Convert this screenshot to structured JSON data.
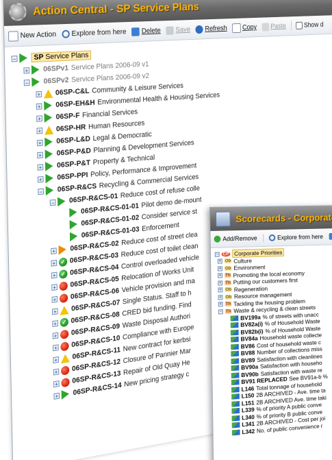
{
  "main_window": {
    "title": "Action Central - SP Service Plans",
    "toolbar": {
      "new_action": "New Action",
      "explore": "Explore from here",
      "delete": "Delete",
      "save": "Save",
      "refresh": "Refresh",
      "copy": "Copy",
      "paste": "Paste",
      "show": "Show d"
    },
    "root": {
      "code": "SP",
      "label": "Service Plans"
    },
    "items": [
      {
        "code": "06SPv1",
        "desc": "Service Plans 2006-09 v1",
        "status": "flag-green",
        "grey": true,
        "indent": 1,
        "exp": "+"
      },
      {
        "code": "06SPv2",
        "desc": "Service Plans 2006-09 v2",
        "status": "flag-green",
        "grey": true,
        "indent": 1,
        "exp": "-"
      },
      {
        "code": "06SP-C&L",
        "desc": "Community & Leisure Services",
        "status": "triangle",
        "indent": 2,
        "exp": "+"
      },
      {
        "code": "06SP-EH&H",
        "desc": "Environmental Health & Housing Services",
        "status": "flag-green",
        "indent": 2,
        "exp": "+"
      },
      {
        "code": "06SP-F",
        "desc": "Financial Services",
        "status": "flag-green",
        "indent": 2,
        "exp": "+"
      },
      {
        "code": "06SP-HR",
        "desc": "Human Resources",
        "status": "triangle",
        "indent": 2,
        "exp": "+"
      },
      {
        "code": "06SP-L&D",
        "desc": "Legal & Democratic",
        "status": "flag-green",
        "indent": 2,
        "exp": "+"
      },
      {
        "code": "06SP-P&D",
        "desc": "Planning & Development Services",
        "status": "flag-green",
        "indent": 2,
        "exp": "+"
      },
      {
        "code": "06SP-P&T",
        "desc": "Property & Technical",
        "status": "flag-green",
        "indent": 2,
        "exp": "+"
      },
      {
        "code": "06SP-PPI",
        "desc": "Policy, Performance & Improvement",
        "status": "flag-green",
        "indent": 2,
        "exp": "+"
      },
      {
        "code": "06SP-R&CS",
        "desc": "Recycling & Commercial Services",
        "status": "flag-green",
        "indent": 2,
        "exp": "-"
      },
      {
        "code": "06SP-R&CS-01",
        "desc": "Reduce cost of refuse colle",
        "status": "flag-green",
        "indent": 3,
        "exp": "-"
      },
      {
        "code": "06SP-R&CS-01-01",
        "desc": "Pilot demo de-mount",
        "status": "flag-green",
        "indent": 4,
        "exp": ""
      },
      {
        "code": "06SP-R&CS-01-02",
        "desc": "Consider service st",
        "status": "flag-green",
        "indent": 4,
        "exp": ""
      },
      {
        "code": "06SP-R&CS-01-03",
        "desc": "Enforcement",
        "status": "flag-green",
        "indent": 4,
        "exp": ""
      },
      {
        "code": "06SP-R&CS-02",
        "desc": "Reduce cost of street clea",
        "status": "flag-orange",
        "indent": 3,
        "exp": "+"
      },
      {
        "code": "06SP-R&CS-03",
        "desc": "Reduce cost of toilet clean",
        "status": "check",
        "indent": 3,
        "exp": "+"
      },
      {
        "code": "06SP-R&CS-04",
        "desc": "Control overloaded vehicle",
        "status": "check",
        "indent": 3,
        "exp": "+"
      },
      {
        "code": "06SP-R&CS-05",
        "desc": "Relocation of Works Unit",
        "status": "red",
        "indent": 3,
        "exp": "+"
      },
      {
        "code": "06SP-R&CS-06",
        "desc": "Vehicle provision and ma",
        "status": "red",
        "indent": 3,
        "exp": "+"
      },
      {
        "code": "06SP-R&CS-07",
        "desc": "Single Status. Staff to h",
        "status": "triangle",
        "indent": 3,
        "exp": "+"
      },
      {
        "code": "06SP-R&CS-08",
        "desc": "CRED bid funding. Find",
        "status": "check",
        "indent": 3,
        "exp": "+"
      },
      {
        "code": "06SP-R&CS-09",
        "desc": "Waste Disposal Authori",
        "status": "red",
        "indent": 3,
        "exp": "+"
      },
      {
        "code": "06SP-R&CS-10",
        "desc": "Compliance with Europe",
        "status": "red",
        "indent": 3,
        "exp": "+"
      },
      {
        "code": "06SP-R&CS-11",
        "desc": "New contract for kerbsi",
        "status": "triangle",
        "indent": 3,
        "exp": "+"
      },
      {
        "code": "06SP-R&CS-12",
        "desc": "Closure of Pannier Mar",
        "status": "red",
        "indent": 3,
        "exp": "+"
      },
      {
        "code": "06SP-R&CS-13",
        "desc": "Repair of Old Quay He",
        "status": "red",
        "indent": 3,
        "exp": "+"
      },
      {
        "code": "06SP-R&CS-14",
        "desc": "New pricing strategy c",
        "status": "flag-green",
        "indent": 3,
        "exp": "+"
      }
    ]
  },
  "scorecard_window": {
    "title": "Scorecards - Corporate Pri",
    "toolbar": {
      "add_remove": "Add/Remove",
      "explore": "Explore from here"
    },
    "root": {
      "badge": "CP",
      "label": "Corporate Priorities"
    },
    "items": [
      {
        "badge": "Ob",
        "label": "Culture",
        "indent": 1
      },
      {
        "badge": "Ob",
        "label": "Environment",
        "indent": 1
      },
      {
        "badge": "Th",
        "label": "Promoting the local economy",
        "indent": 1
      },
      {
        "badge": "Th",
        "label": "Putting our customers first",
        "indent": 1
      },
      {
        "badge": "Ob",
        "label": "Regeneration",
        "indent": 1
      },
      {
        "badge": "Ob",
        "label": "Resource management",
        "indent": 1
      },
      {
        "badge": "Th",
        "label": "Tackling the housing problem",
        "indent": 1
      },
      {
        "badge": "Th",
        "label": "Waste & recycling & clean streets",
        "indent": 1,
        "expanded": true
      },
      {
        "code": "BV199a",
        "label": "% of streets with unacc",
        "indent": 2
      },
      {
        "code": "BV82a(i)",
        "label": "% of Household Waste",
        "indent": 2
      },
      {
        "code": "BV82b(i)",
        "label": "% of Household Waste",
        "indent": 2
      },
      {
        "code": "BV84a",
        "label": "Household waste collecte",
        "indent": 2
      },
      {
        "code": "BV86",
        "label": "Cost of household waste c",
        "indent": 2
      },
      {
        "code": "BV88",
        "label": "Number of collections miss",
        "indent": 2
      },
      {
        "code": "BV89",
        "label": "Satisfaction with cleanlines",
        "indent": 2
      },
      {
        "code": "BV90a",
        "label": "Satisfaction with househo",
        "indent": 2
      },
      {
        "code": "BV90b",
        "label": "Satisfaction with waste re",
        "indent": 2
      },
      {
        "code": "BV91 REPLACED",
        "label": "See BV91a-b %",
        "indent": 2
      },
      {
        "code": "L146",
        "label": "Total tonnage of household",
        "indent": 2
      },
      {
        "code": "L150",
        "label": "2B ARCHIVED - Ave. time ta",
        "indent": 2
      },
      {
        "code": "L151",
        "label": "2B ARCHIVED Ave. time taki",
        "indent": 2
      },
      {
        "code": "L339",
        "label": "% of priority A public conve",
        "indent": 2
      },
      {
        "code": "L340",
        "label": "% of priority B public conve",
        "indent": 2
      },
      {
        "code": "L341",
        "label": "2B ARCHIVED - Cost per joi",
        "indent": 2
      },
      {
        "code": "L342",
        "label": "No. of public convenience r",
        "indent": 2
      }
    ]
  },
  "colors": {
    "title_text": "#ffb400",
    "selection": "#ffe9a8",
    "status_green": "#2fa52f",
    "status_red": "#d21d0b",
    "status_amber": "#f3c20c"
  }
}
